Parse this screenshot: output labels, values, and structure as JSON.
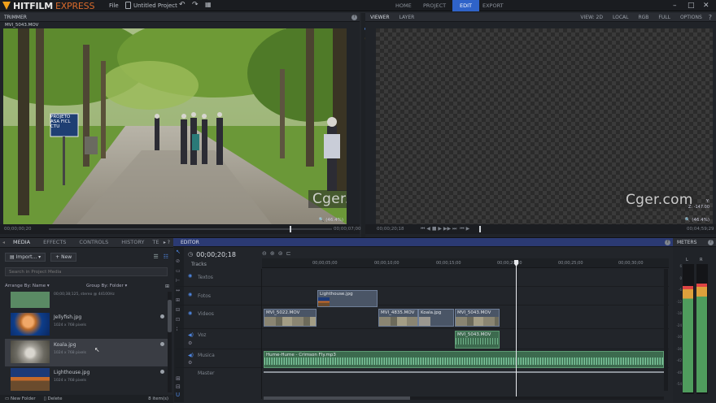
{
  "app": {
    "logo_main": "HITFILM",
    "logo_sub": "EXPRESS",
    "menu_file": "File",
    "project_name": "Untitled Project"
  },
  "nav": {
    "tabs": [
      "HOME",
      "PROJECT",
      "EDIT",
      "EXPORT"
    ],
    "active": "EDIT"
  },
  "trimmer": {
    "title": "TRIMMER",
    "clip_name": "MVI_5043.MOV",
    "sign_text": "PROJETO\nASA FICL\nCTU",
    "watermark": "Cger.com",
    "time_start": "00;00;00;20",
    "time_end": "00;00;07;00",
    "zoom": "(46.4%)"
  },
  "viewer": {
    "tabs": [
      "VIEWER",
      "LAYER"
    ],
    "view": "VIEW: 2D",
    "local": "LOCAL",
    "rgb": "RGB",
    "full": "FULL",
    "options": "OPTIONS",
    "watermark": "Cger.com",
    "time_start": "00;00;20;18",
    "time_end": "00;04;59;29",
    "zoom": "(46.4%)",
    "coord_y": "Y:",
    "coord_z": "Z: -147.00"
  },
  "media": {
    "tabs": [
      "MEDIA",
      "EFFECTS",
      "CONTROLS",
      "HISTORY",
      "TE"
    ],
    "import_label": "Import...",
    "new_label": "New",
    "search_placeholder": "Search in Project Media",
    "arrange": "Arrange By: Name",
    "group": "Group By: Folder",
    "items": [
      {
        "name": "",
        "sub": "00;00;38;125, stereo @ 44100Hz"
      },
      {
        "name": "Jellyfish.jpg",
        "sub": "1024 x 768 pixels"
      },
      {
        "name": "Koala.jpg",
        "sub": "1024 x 768 pixels"
      },
      {
        "name": "Lighthouse.jpg",
        "sub": "1024 x 768 pixels"
      }
    ],
    "new_folder": "New Folder",
    "delete": "Delete",
    "count": "8 item(s)"
  },
  "editor": {
    "title": "EDITOR",
    "timecode": "00;00;20;18",
    "tracks_label": "Tracks",
    "ruler": [
      "00;00;00;00",
      "00;00;05;00",
      "00;00;10;00",
      "00;00;15;00",
      "00;00;20;00",
      "00;00;25;00",
      "00;00;30;00"
    ],
    "tracks": {
      "texto": "Textos",
      "fotos": "Fotos",
      "videos": "Videos",
      "voz": "Voz",
      "musica": "Musica",
      "master": "Master"
    },
    "clips": {
      "lighthouse": "Lighthouse.jpg",
      "v1": "MVI_5022.MOV",
      "v2": "MVI_4835.MOV",
      "koala": "Koala.jpg",
      "v3": "MVI_5043.MOV",
      "voz": "MVI_5043.MOV",
      "music": "Hume-Hume - Crimson Fly.mp3"
    }
  },
  "meters": {
    "title": "METERS",
    "l": "L",
    "r": "R",
    "scale": [
      "6",
      "0",
      "-6",
      "-12",
      "-18",
      "-24",
      "-30",
      "-36",
      "-42",
      "-48",
      "-54"
    ],
    "level_l": 0.82,
    "level_r": 0.84
  }
}
